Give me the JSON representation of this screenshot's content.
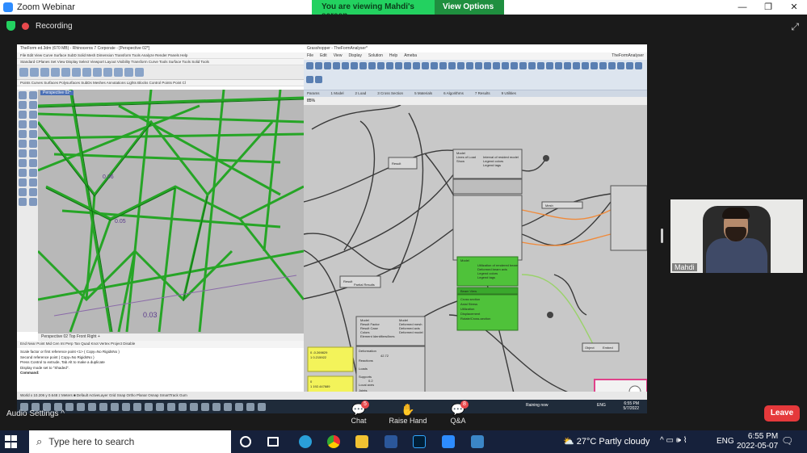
{
  "zoom": {
    "app_title": "Zoom Webinar",
    "banner_viewing": "You are viewing Mahdi's screen",
    "banner_options": "View Options ⌄",
    "window_controls": [
      "—",
      "❐",
      "✕"
    ],
    "recording_label": "Recording",
    "participant_name": "Mahdi",
    "audio_settings": "Audio Settings ^",
    "chat_label": "Chat",
    "chat_badge": "5",
    "raise_hand_label": "Raise Hand",
    "qa_label": "Q&A",
    "qa_badge": "8",
    "leave_label": "Leave"
  },
  "rhino": {
    "title": "TheForm ed.3dm (670 MB) - Rhinoceros 7 Corporate - [Perspective 02*]",
    "menu": "File  Edit  View  Curve  Surface  SubD  Solid  Mesh  Dimension  Transform  Tools  Analyze  Render  Panels  Help",
    "tabs": "Standard  CPlanes  Set View  Display  Select  Viewport Layout  Visibility  Transform  Curve Tools  Surface Tools  Solid Tools",
    "filters": "Points  Curves  Surfaces  Polysurfaces  SubDs  Meshes  Annotations  Lights  Blocks  Control Points  Point Cl",
    "viewport_label": "Perspective 02*",
    "viewport_tabs": "Perspective 02   Top   Front   Right   +",
    "osnap": "End  Near  Point  Mid  Cen  Int  Perp  Tan  Quad  Knot  Vertex  Project  Disable",
    "command_lines": [
      "Scale factor or first reference point <1> ( Copy=No  RigidsNo )",
      "Second reference point ( Copy=No  RigidsNo )",
      "Press Control to extrude, Tab Alt to make a duplicate",
      "Display mode set to \"Shaded\".",
      "Command:"
    ],
    "status": "World    x 10.206    y 0.648    z    Meters    ■ Default    ActiveLayer    Grid Snap  Ortho  Planar  Osnap  SmartTrack  Gum",
    "labels": [
      "0.03",
      "0.05",
      "0.06"
    ]
  },
  "grasshopper": {
    "title": "Grasshopper - TheFormAnalyser*",
    "menu": [
      "File",
      "Edit",
      "View",
      "Display",
      "Solution",
      "Help",
      "Ameba"
    ],
    "menu_right": "TheFormAnalyser",
    "panels": [
      "Params",
      "1 Model",
      "2 Load",
      "3 Cross Section",
      "5 Materials",
      "6 Algorithms",
      "7 Results",
      "9 Utilities"
    ],
    "zoom_level": "85%",
    "footer": "Autosave complete (288 seconds ago)",
    "footer_right": "1.0.0007",
    "nodes": {
      "model_view_1": [
        "Model",
        "Lines of Load",
        "Show",
        "Interval of resided model",
        "Legend colors",
        "Legend tags"
      ],
      "model_view_2": [
        "Model",
        "Result Factor",
        "Result Case",
        "Colors",
        "Element Identifiers/lines"
      ],
      "model_view_2_out": [
        "Model",
        "Deformed mesh",
        "Deformed axis",
        "Deformed model"
      ],
      "green_node": [
        "Model",
        "Utilization of rendered beam",
        "Deformed beam axis",
        "Legend colors",
        "Legend tags"
      ],
      "beam_settings": [
        "Cross section",
        "Axial Stress",
        "Utilization",
        "Displacement",
        "Rotate/Cross-section"
      ],
      "result_options": [
        "Deformation",
        "Reactions",
        "Loads",
        "Supports",
        "Local axes",
        "Joints"
      ],
      "slider_value": "42.72",
      "slider_value_2": "0.2",
      "panel_yellow_1": [
        "0 -0.269829",
        "1 0.215922"
      ],
      "panel_yellow_2": [
        "0",
        "1 192.447689"
      ],
      "panel_yellow_3": [
        "0 -1.261313"
      ],
      "beam_view_label": "Beam View",
      "resuL": "Result",
      "partial_results": "Partial Results",
      "mesh_label": "Mesh",
      "object_label": "Object",
      "embed_label": "Embed"
    }
  },
  "inner_taskbar": {
    "weather": "Raining now",
    "lang": "ENG",
    "clock_time": "6:55 PM",
    "clock_date": "5/7/2022"
  },
  "windows": {
    "search_placeholder": "Type here to search",
    "weather_temp": "27°C",
    "weather_desc": "Partly cloudy",
    "tray_icons": "^  ▭  🕪  ⌇",
    "lang": "ENG",
    "clock_time": "6:55 PM",
    "clock_date": "2022-05-07",
    "colors": {
      "taskbar": "#16213b",
      "zoom_green": "#23d160",
      "leave_red": "#e5393b",
      "truss_green": "#1fa51f"
    }
  }
}
